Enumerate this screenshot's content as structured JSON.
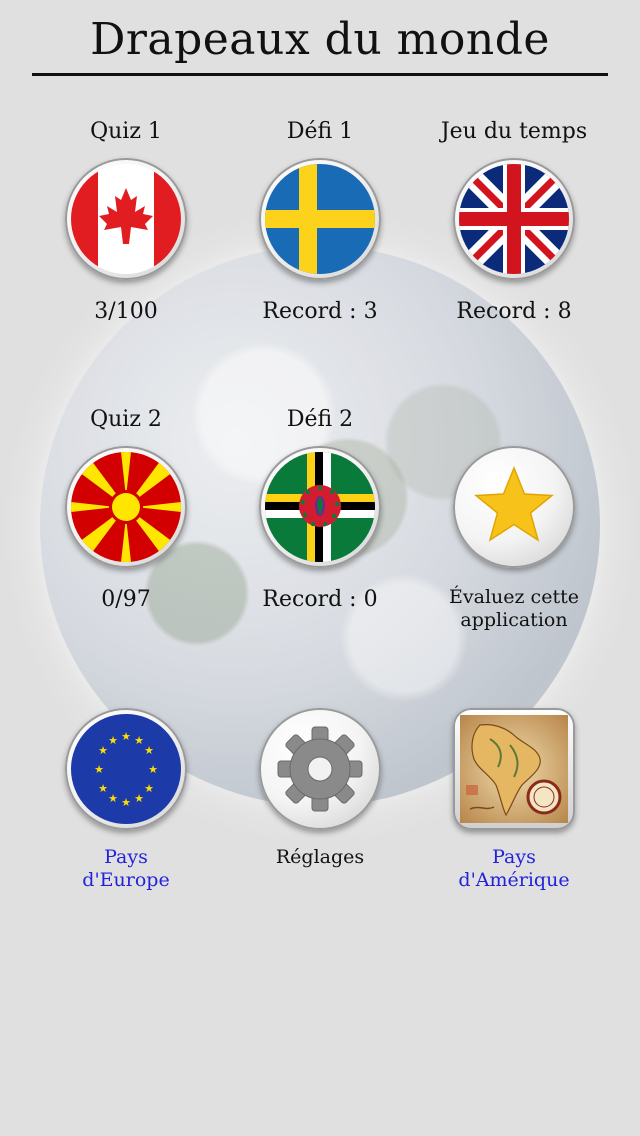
{
  "header": {
    "title": "Drapeaux du monde"
  },
  "tiles": [
    {
      "label": "Quiz 1",
      "sub": "3/100",
      "icon": "canada-flag-icon"
    },
    {
      "label": "Défi 1",
      "sub": "Record : 3",
      "icon": "sweden-flag-icon"
    },
    {
      "label": "Jeu du temps",
      "sub": "Record : 8",
      "icon": "uk-flag-icon"
    },
    {
      "label": "Quiz 2",
      "sub": "0/97",
      "icon": "north-macedonia-flag-icon"
    },
    {
      "label": "Défi 2",
      "sub": "Record : 0",
      "icon": "dominica-flag-icon"
    },
    {
      "sub_line1": "Évaluez cette",
      "sub_line2": "application",
      "icon": "star-icon"
    },
    {
      "sub_line1": "Pays",
      "sub_line2": "d'Europe",
      "icon": "eu-flag-icon"
    },
    {
      "sub_line1": "Réglages",
      "icon": "gear-icon"
    },
    {
      "sub_line1": "Pays",
      "sub_line2": "d'Amérique",
      "icon": "south-america-map-icon"
    }
  ],
  "colors": {
    "link": "#2222dd",
    "background": "#e0e0e0",
    "star": "#f7c21a"
  }
}
